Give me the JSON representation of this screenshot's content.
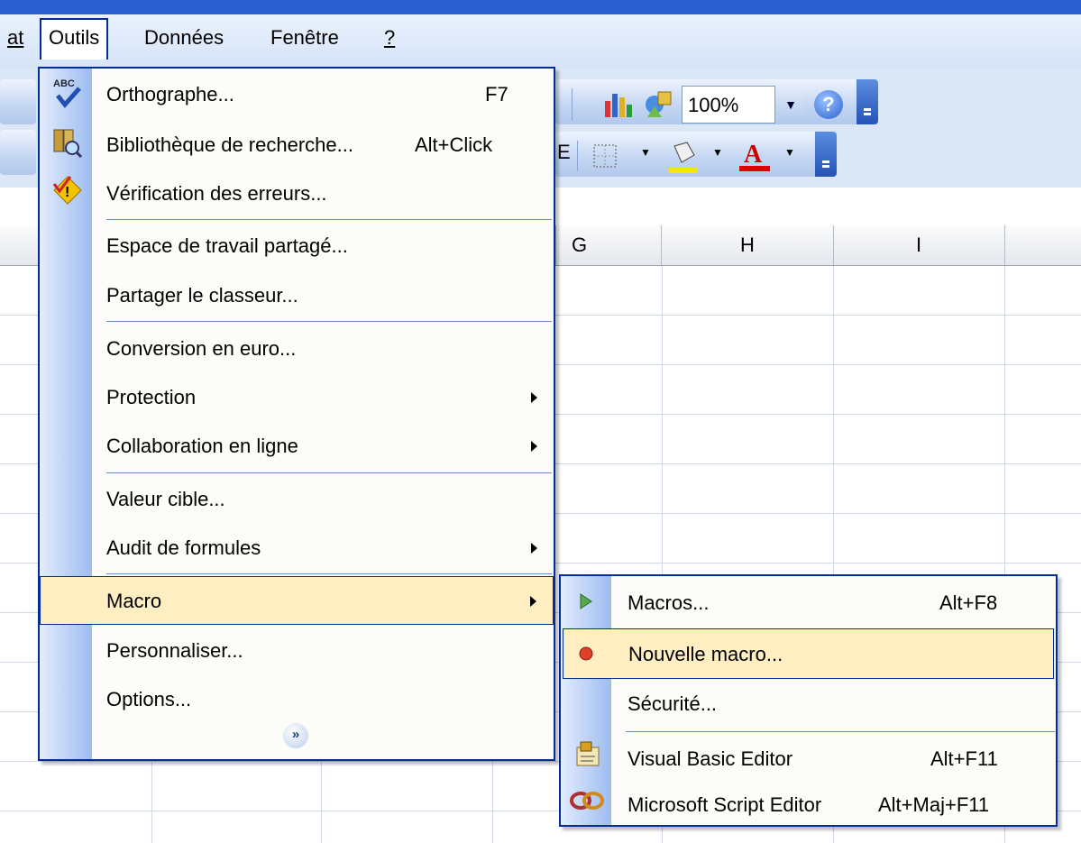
{
  "menubar": {
    "items": [
      {
        "label": "at"
      },
      {
        "label": "Outils"
      },
      {
        "label": "Données"
      },
      {
        "label": "Fenêtre"
      },
      {
        "label": "?"
      }
    ]
  },
  "toolbar": {
    "zoom_value": "100%",
    "icons": [
      "spelling-abc-icon",
      "research-icon",
      "error-check-icon",
      "chart-wizard-icon",
      "drawing-icon",
      "help-icon",
      "borders-icon",
      "fill-color-icon",
      "font-color-icon"
    ]
  },
  "sheet": {
    "columns": [
      "G",
      "H",
      "I"
    ]
  },
  "tools_menu": {
    "items": [
      {
        "label": "Orthographe...",
        "shortcut": "F7"
      },
      {
        "label": "Bibliothèque de recherche...",
        "shortcut": "Alt+Click"
      },
      {
        "label": "Vérification des erreurs...",
        "shortcut": ""
      },
      {
        "label": "Espace de travail partagé...",
        "shortcut": ""
      },
      {
        "label": "Partager le classeur...",
        "shortcut": ""
      },
      {
        "label": "Conversion en euro...",
        "shortcut": ""
      },
      {
        "label": "Protection",
        "shortcut": ""
      },
      {
        "label": "Collaboration en ligne",
        "shortcut": ""
      },
      {
        "label": "Valeur cible...",
        "shortcut": ""
      },
      {
        "label": "Audit de formules",
        "shortcut": ""
      },
      {
        "label": "Macro",
        "shortcut": ""
      },
      {
        "label": "Personnaliser...",
        "shortcut": ""
      },
      {
        "label": "Options...",
        "shortcut": ""
      }
    ]
  },
  "macro_menu": {
    "items": [
      {
        "label": "Macros...",
        "shortcut": "Alt+F8"
      },
      {
        "label": "Nouvelle macro...",
        "shortcut": ""
      },
      {
        "label": "Sécurité...",
        "shortcut": ""
      },
      {
        "label": "Visual Basic Editor",
        "shortcut": "Alt+F11"
      },
      {
        "label": "Microsoft Script Editor",
        "shortcut": "Alt+Maj+F11"
      }
    ]
  },
  "colors": {
    "menu_border": "#002d96",
    "highlight": "#ffeec2",
    "title_bar": "#2a5fd1"
  }
}
